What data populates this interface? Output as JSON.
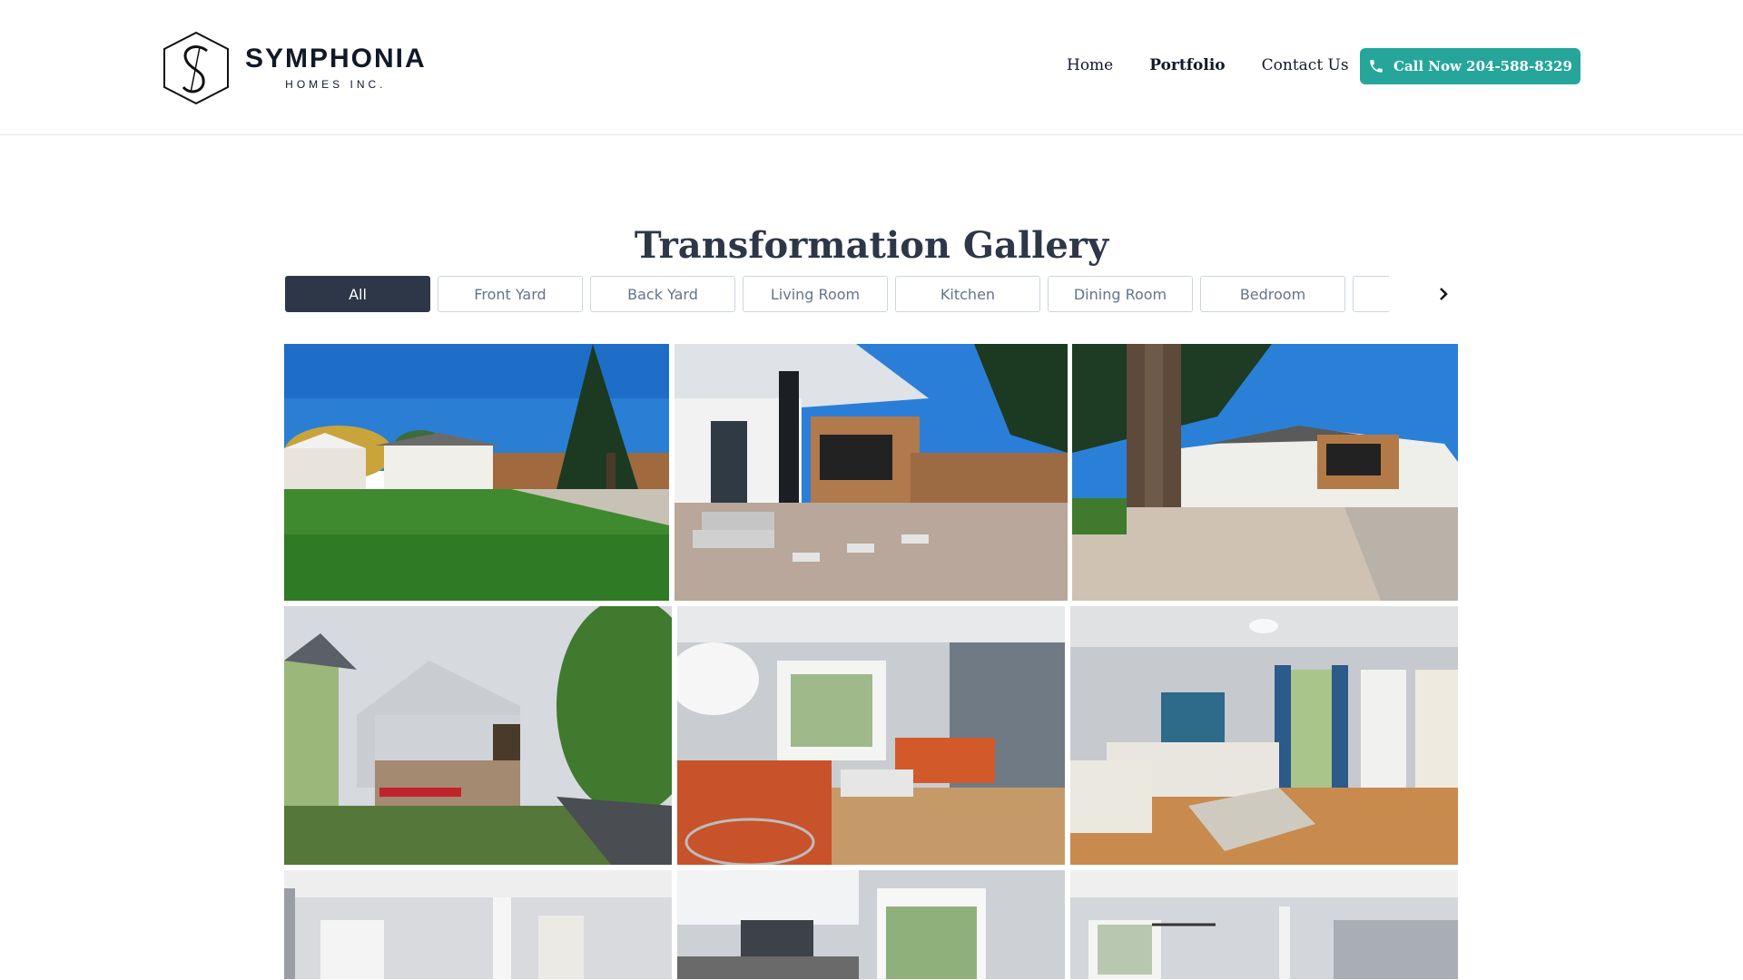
{
  "brand": {
    "name": "SYMPHONIA",
    "subtitle": "HOMES INC."
  },
  "nav": {
    "items": [
      {
        "label": "Home"
      },
      {
        "label": "Portfolio",
        "active": true
      },
      {
        "label": "Contact Us"
      }
    ]
  },
  "cta": {
    "label": "Call Now 204-588-8329",
    "icon": "phone-icon",
    "color": "#26a69a"
  },
  "gallery": {
    "title": "Transformation Gallery",
    "filters": [
      {
        "label": "All",
        "active": true
      },
      {
        "label": "Front Yard"
      },
      {
        "label": "Back Yard"
      },
      {
        "label": "Living Room"
      },
      {
        "label": "Kitchen"
      },
      {
        "label": "Dining Room"
      },
      {
        "label": "Bedroom"
      },
      {
        "label": ""
      }
    ],
    "next_icon": "chevron-right-icon",
    "photos": [
      {
        "subject": "house-front-lawn-with-pine-tree"
      },
      {
        "subject": "front-entrance-with-stone-path"
      },
      {
        "subject": "house-behind-large-tree-trunk"
      },
      {
        "subject": "grey-siding-bungalow-with-flower-bed"
      },
      {
        "subject": "living-room-with-orange-sofas"
      },
      {
        "subject": "living-room-with-blue-curtains"
      },
      {
        "subject": "bright-interior-hallway"
      },
      {
        "subject": "white-kitchen-with-microwave"
      },
      {
        "subject": "open-dining-area"
      }
    ]
  },
  "colors": {
    "accent": "#26a69a",
    "dark": "#2d3748"
  }
}
